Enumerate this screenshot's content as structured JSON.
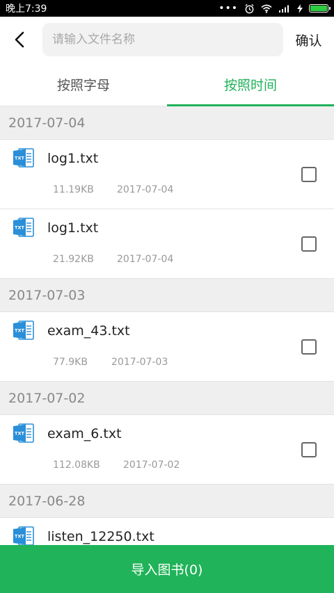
{
  "status_bar": {
    "time": "晚上7:39",
    "icons": [
      "more-dots-icon",
      "alarm-icon",
      "wifi-icon",
      "signal-icon",
      "charging-icon",
      "battery-icon"
    ],
    "battery_color": "#2ecc40"
  },
  "header": {
    "search_placeholder": "请输入文件名称",
    "search_value": "",
    "confirm_label": "确认"
  },
  "tabs": [
    {
      "label": "按照字母",
      "active": false
    },
    {
      "label": "按照时间",
      "active": true
    }
  ],
  "colors": {
    "accent": "#1fb15a",
    "file_icon": "#2a8fd8"
  },
  "groups": [
    {
      "date": "2017-07-04",
      "files": [
        {
          "name": "log1.txt",
          "size": "11.19KB",
          "date": "2017-07-04"
        },
        {
          "name": "log1.txt",
          "size": "21.92KB",
          "date": "2017-07-04"
        }
      ]
    },
    {
      "date": "2017-07-03",
      "files": [
        {
          "name": "exam_43.txt",
          "size": "77.9KB",
          "date": "2017-07-03"
        }
      ]
    },
    {
      "date": "2017-07-02",
      "files": [
        {
          "name": "exam_6.txt",
          "size": "112.08KB",
          "date": "2017-07-02"
        }
      ]
    },
    {
      "date": "2017-06-28",
      "files": [
        {
          "name": "listen_12250.txt",
          "size": "",
          "date": ""
        }
      ]
    }
  ],
  "file_icon_label": "TXT",
  "import_button_label": "导入图书(0)"
}
